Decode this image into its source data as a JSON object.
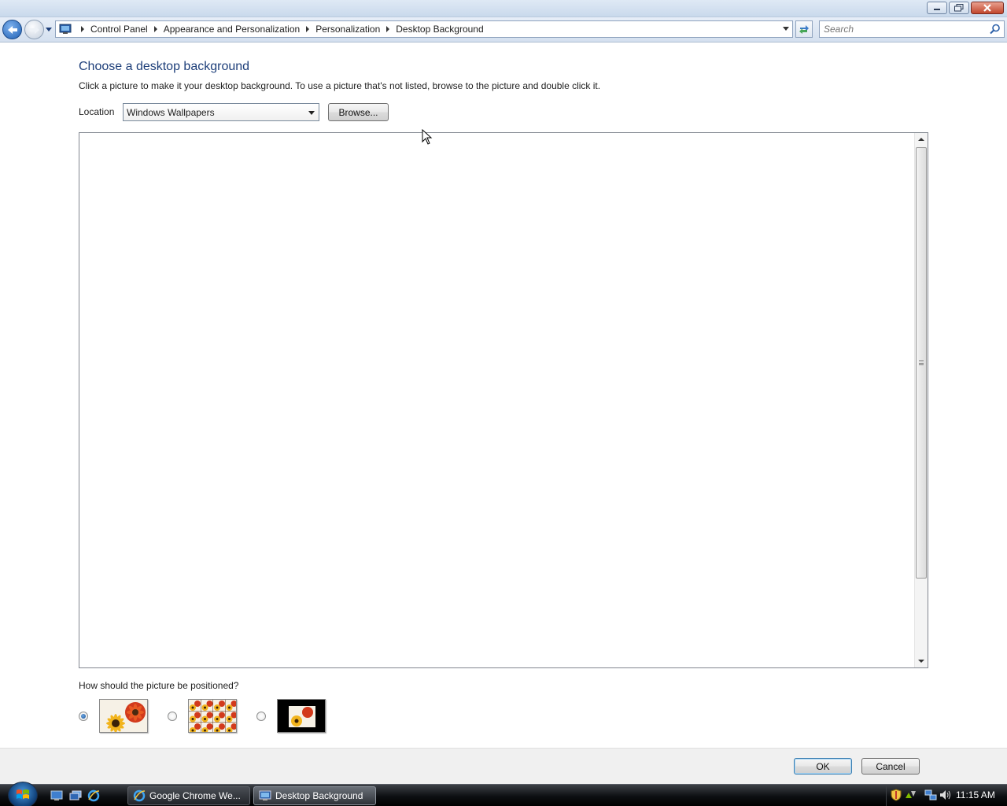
{
  "window": {
    "title_buttons": [
      "minimize-icon",
      "restore-icon",
      "close-icon"
    ]
  },
  "navigation": {
    "breadcrumbs": [
      "Control Panel",
      "Appearance and Personalization",
      "Personalization",
      "Desktop Background"
    ],
    "search_placeholder": "Search"
  },
  "main": {
    "title": "Choose a desktop background",
    "description": "Click a picture to make it your desktop background. To use a picture that's not listed, browse to the picture and double click it.",
    "location_label": "Location",
    "location_value": "Windows Wallpapers",
    "browse_label": "Browse...",
    "position_question": "How should the picture be positioned?",
    "position_options": [
      {
        "name": "fit-to-screen",
        "selected": true
      },
      {
        "name": "tile",
        "selected": false
      },
      {
        "name": "center",
        "selected": false
      }
    ]
  },
  "footer": {
    "ok_label": "OK",
    "cancel_label": "Cancel"
  },
  "taskbar": {
    "tasks": [
      {
        "label": "Google Chrome We...",
        "active": false
      },
      {
        "label": "Desktop Background",
        "active": true
      }
    ],
    "clock": "11:15 AM"
  },
  "colors": {
    "title_blue": "#1e3f7a",
    "selection_blue": "#3c7fb1"
  }
}
